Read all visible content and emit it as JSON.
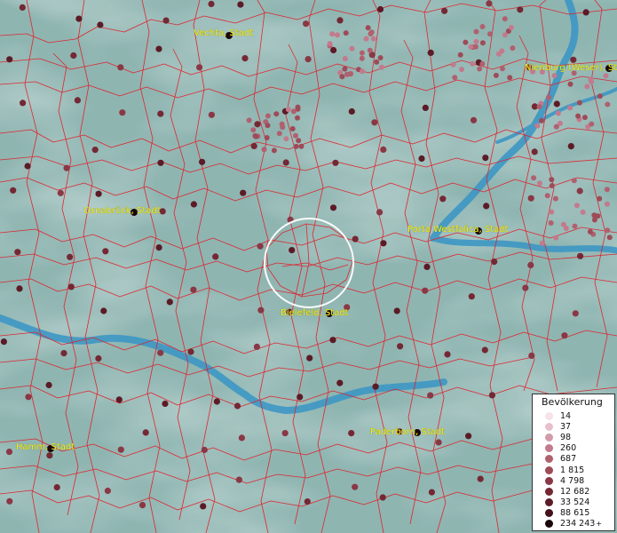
{
  "map": {
    "cities": [
      {
        "name": "Vechta, Stadt",
        "dot": [
          258,
          40
        ],
        "label": [
          218,
          40
        ]
      },
      {
        "name": "Nienburg (Weser), St",
        "dot": [
          686,
          77
        ],
        "label": [
          591,
          79
        ]
      },
      {
        "name": "Osnabrück, Stadt",
        "dot": [
          151,
          239
        ],
        "label": [
          94,
          240
        ]
      },
      {
        "name": "Porta Westfalica, Stadt",
        "dot": [
          539,
          260
        ],
        "label": [
          459,
          261
        ]
      },
      {
        "name": "Bielefeld, Stadt",
        "dot": [
          371,
          353
        ],
        "label": [
          316,
          355
        ]
      },
      {
        "name": "Paderborn, Stadt",
        "dot": [
          470,
          487
        ],
        "label": [
          417,
          489
        ]
      },
      {
        "name": "Hamm, Stadt",
        "dot": [
          57,
          505
        ],
        "label": [
          18,
          506
        ]
      }
    ],
    "colors": {
      "terrain": "#8fb5b1",
      "border": "#e0202a",
      "river": "#3d97c4",
      "label": "#f2f21a",
      "circle": "#ffffff"
    }
  },
  "legend": {
    "title": "Bevölkerung",
    "plus": "+",
    "entries": [
      {
        "label": "14",
        "color": "#f7e1ea"
      },
      {
        "label": "37",
        "color": "#e8bfcc"
      },
      {
        "label": "98",
        "color": "#d49aaa"
      },
      {
        "label": "260",
        "color": "#c27a8c"
      },
      {
        "label": "687",
        "color": "#b0606f"
      },
      {
        "label": "1 815",
        "color": "#9e4b58"
      },
      {
        "label": "4 798",
        "color": "#8a3845"
      },
      {
        "label": "12 682",
        "color": "#742834"
      },
      {
        "label": "33 524",
        "color": "#5c1b26"
      },
      {
        "label": "88 615",
        "color": "#44111a"
      },
      {
        "label": "234 243",
        "color": "#1c0608"
      }
    ]
  }
}
